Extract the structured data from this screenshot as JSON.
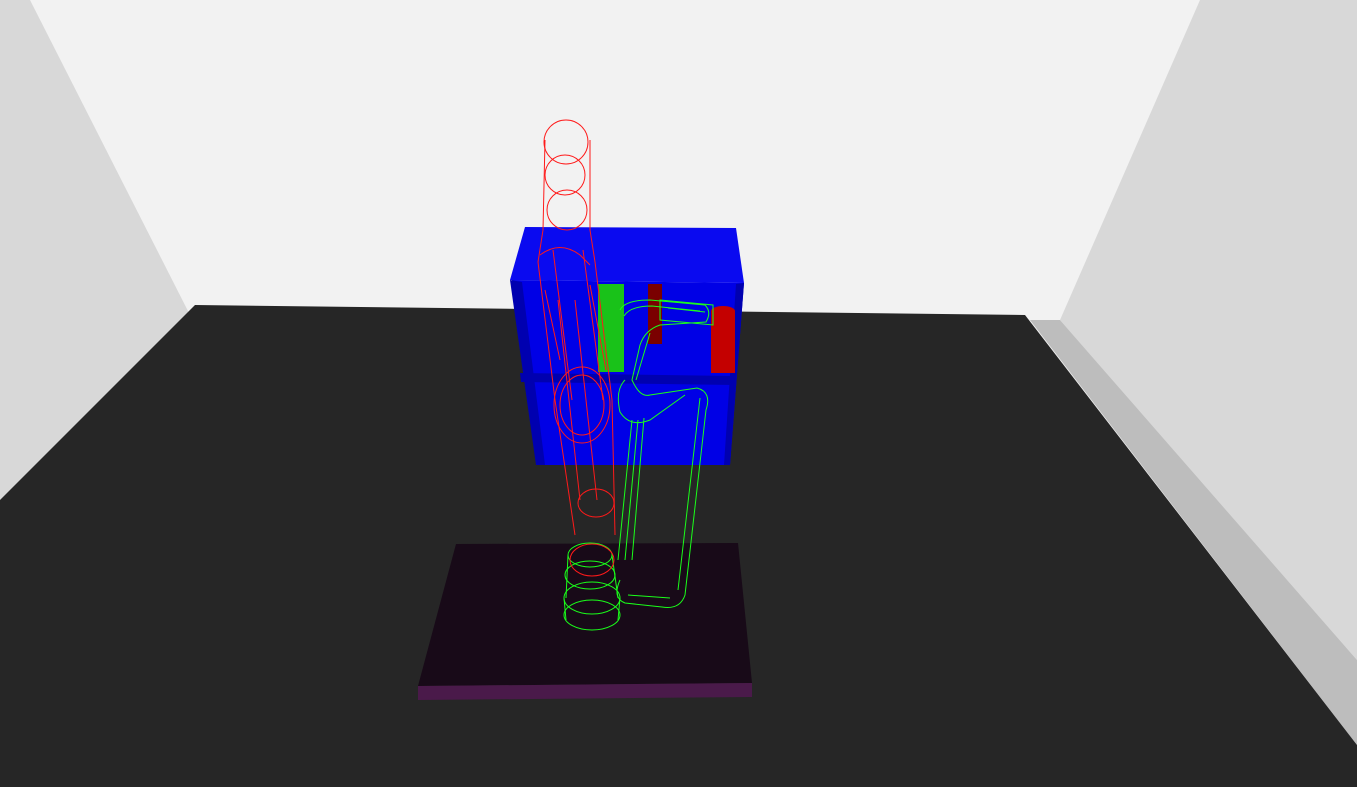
{
  "scene": {
    "colors": {
      "back_wall": "#f2f2f2",
      "left_wall": "#d8d8d8",
      "right_wall": "#d8d8d8",
      "right_wall_edge": "#bdbdbd",
      "floor": "#262626",
      "table_top": "#180a18",
      "table_front": "#4a1a4a",
      "shelf_blue": "#0000e6",
      "shelf_blue_dark": "#0000b0",
      "shelf_blue_top": "#0a0af0",
      "robot_current": "#ff1a1a",
      "robot_goal": "#1aff1a",
      "object_green": "#19c219",
      "object_dark_red": "#7a0000",
      "object_red": "#c40000"
    },
    "objects": {
      "robot_current_pose": "red-wireframe-arm",
      "robot_goal_pose": "green-wireframe-arm",
      "shelf": "blue-bookshelf",
      "table": "dark-table",
      "items": [
        "green-box",
        "dark-red-cylinder",
        "red-cylinder"
      ]
    }
  }
}
